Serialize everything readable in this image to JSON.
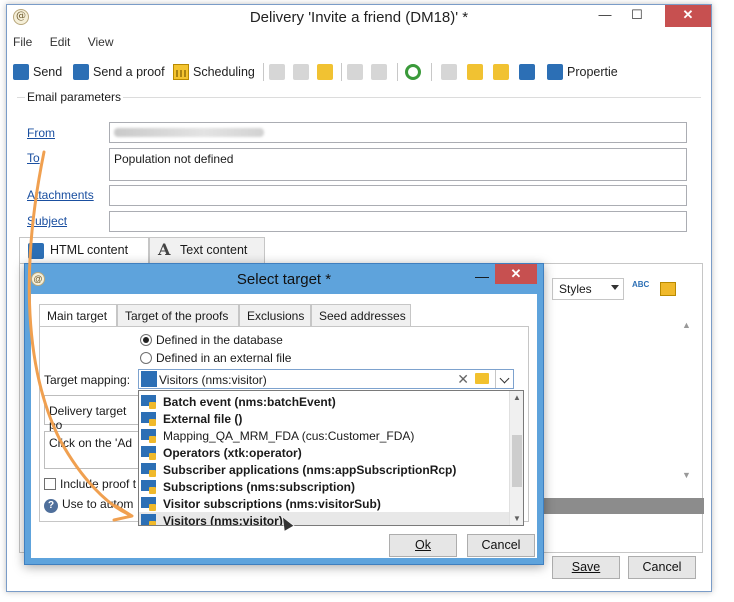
{
  "window": {
    "title": "Delivery 'Invite a friend (DM18)' *",
    "controls": {
      "minimize": "—",
      "maximize": "☐",
      "close": "✕"
    }
  },
  "menu": [
    "File",
    "Edit",
    "View"
  ],
  "toolbar": {
    "send": "Send",
    "send_proof": "Send a proof",
    "scheduling": "Scheduling",
    "properties": "Propertie"
  },
  "email_parameters": {
    "legend": "Email parameters",
    "from_label": "From",
    "to_label": "To",
    "to_value": "Population not defined",
    "attachments_label": "Attachments",
    "subject_label": "Subject"
  },
  "content_tabs": {
    "html": "HTML content",
    "text": "Text content",
    "styles": "Styles"
  },
  "main_buttons": {
    "save": "Save",
    "cancel": "Cancel"
  },
  "dialog": {
    "title": "Select target *",
    "tabs": [
      "Main target",
      "Target of the proofs",
      "Exclusions",
      "Seed addresses"
    ],
    "radio_db": "Defined in the database",
    "radio_ext": "Defined in an external file",
    "mapping_label": "Target mapping:",
    "mapping_value": "Visitors (nms:visitor)",
    "delivery_target_partial": "Delivery target po",
    "click_partial": "Click on the 'Ad",
    "include_proof_partial": "Include proof t",
    "use_to_partial": "Use to autom",
    "ok": "Ok",
    "cancel": "Cancel",
    "options": [
      {
        "label": "Batch event (nms:batchEvent)",
        "bold": true
      },
      {
        "label": "External file ()",
        "bold": true
      },
      {
        "label": "Mapping_QA_MRM_FDA (cus:Customer_FDA)",
        "bold": false
      },
      {
        "label": "Operators (xtk:operator)",
        "bold": true
      },
      {
        "label": "Subscriber applications (nms:appSubscriptionRcp)",
        "bold": true
      },
      {
        "label": "Subscriptions (nms:subscription)",
        "bold": true
      },
      {
        "label": "Visitor subscriptions (nms:visitorSub)",
        "bold": true
      },
      {
        "label": "Visitors (nms:visitor)",
        "bold": true
      }
    ]
  },
  "colors": {
    "accent": "#2c6fb5",
    "dialog_frame": "#5ea3dc",
    "arrow": "#f0a050",
    "close": "#c75050"
  }
}
